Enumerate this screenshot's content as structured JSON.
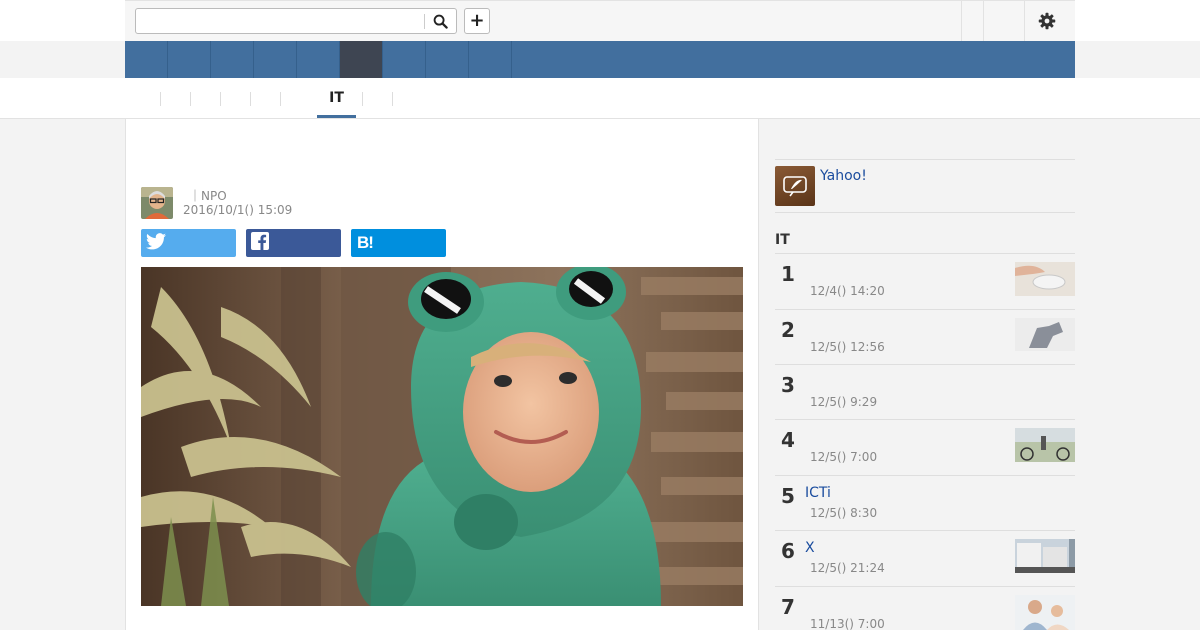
{
  "header": {
    "search": {
      "value": "",
      "placeholder": ""
    },
    "add_label": "+",
    "icons": {
      "search": "search-icon",
      "gear": "gear-icon"
    }
  },
  "nav": {
    "items": [
      "",
      "",
      "",
      "",
      "",
      "",
      "",
      "",
      ""
    ],
    "active_index": 4
  },
  "subnav": {
    "active_label": "IT"
  },
  "article": {
    "headline": "",
    "author": {
      "byline": "｜NPO",
      "date": "2016/10/1() 15:09"
    },
    "share": {
      "twitter": "",
      "facebook": "",
      "hatena": "B!"
    }
  },
  "sidebar": {
    "promo": {
      "label": "Yahoo!"
    },
    "ranking_title": "IT",
    "ranking": [
      {
        "rank": "1",
        "title": "",
        "date": "12/4() 14:20"
      },
      {
        "rank": "2",
        "title": "",
        "date": "12/5() 12:56"
      },
      {
        "rank": "3",
        "title": "",
        "date": "12/5() 9:29"
      },
      {
        "rank": "4",
        "title": "",
        "date": "12/5() 7:00"
      },
      {
        "rank": "5",
        "title": "ICTi",
        "date": "12/5() 8:30"
      },
      {
        "rank": "6",
        "title": "X",
        "date": "12/5() 21:24"
      },
      {
        "rank": "7",
        "title": "",
        "date": "11/13() 7:00"
      }
    ]
  },
  "colors": {
    "nav": "#426f9e",
    "nav_active": "#3e4552",
    "twitter": "#55acee",
    "facebook": "#3b5998",
    "hatena": "#008fde",
    "link": "#1a4c9e"
  }
}
